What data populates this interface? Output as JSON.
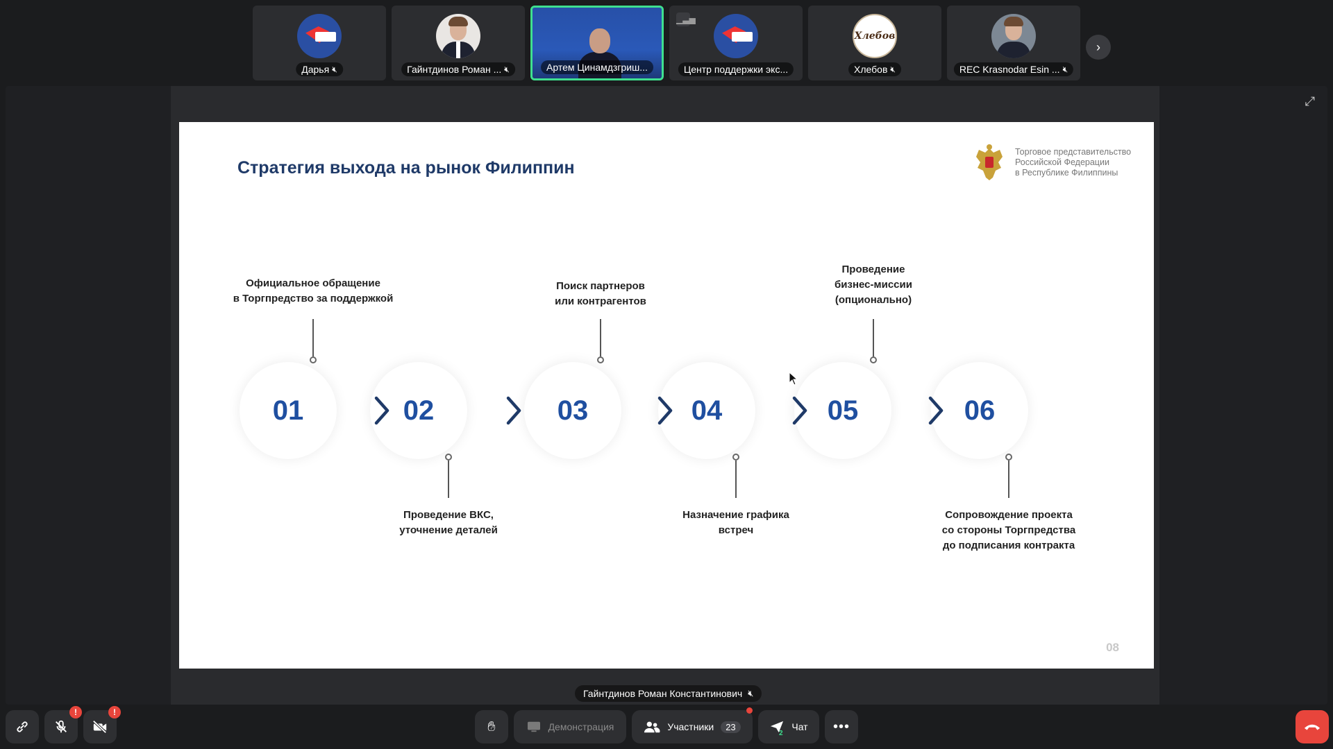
{
  "participants": [
    {
      "name": "Дарья",
      "muted": true
    },
    {
      "name": "Гайнтдинов Роман ...",
      "muted": true
    },
    {
      "name": "Артем Цинамдзгриш...",
      "muted": false
    },
    {
      "name": "Центр поддержки экс...",
      "muted": false
    },
    {
      "name": "Хлебов",
      "muted": true
    },
    {
      "name": "REC Krasnodar Esin ...",
      "muted": true
    }
  ],
  "bread_logo_text": "Хлебов",
  "slide": {
    "title": "Стратегия выхода на рынок Филиппин",
    "org_lines": [
      "Торговое представительство",
      "Российской Федерации",
      "в Республике Филиппины"
    ],
    "page_number": "08",
    "steps": [
      {
        "num": "01",
        "label_lines": [
          "Официальное обращение",
          "в Торгпредство за поддержкой"
        ]
      },
      {
        "num": "02",
        "label_lines": [
          "Проведение ВКС,",
          "уточнение деталей"
        ]
      },
      {
        "num": "03",
        "label_lines": [
          "Поиск партнеров",
          "или контрагентов"
        ]
      },
      {
        "num": "04",
        "label_lines": [
          "Назначение графика",
          "встреч"
        ]
      },
      {
        "num": "05",
        "label_lines": [
          "Проведение",
          "бизнес-миссии",
          "(опционально)"
        ]
      },
      {
        "num": "06",
        "label_lines": [
          "Сопровождение проекта",
          "со стороны Торгпредства",
          "до подписания контракта"
        ]
      }
    ]
  },
  "speaker_name": "Гайнтдинов Роман Константинович",
  "toolbar": {
    "mic_badge": "!",
    "camera_badge": "!",
    "demo_label": "Демонстрация",
    "participants_label": "Участники",
    "participants_count": "23",
    "chat_label": "Чат",
    "chat_unread": "2"
  }
}
